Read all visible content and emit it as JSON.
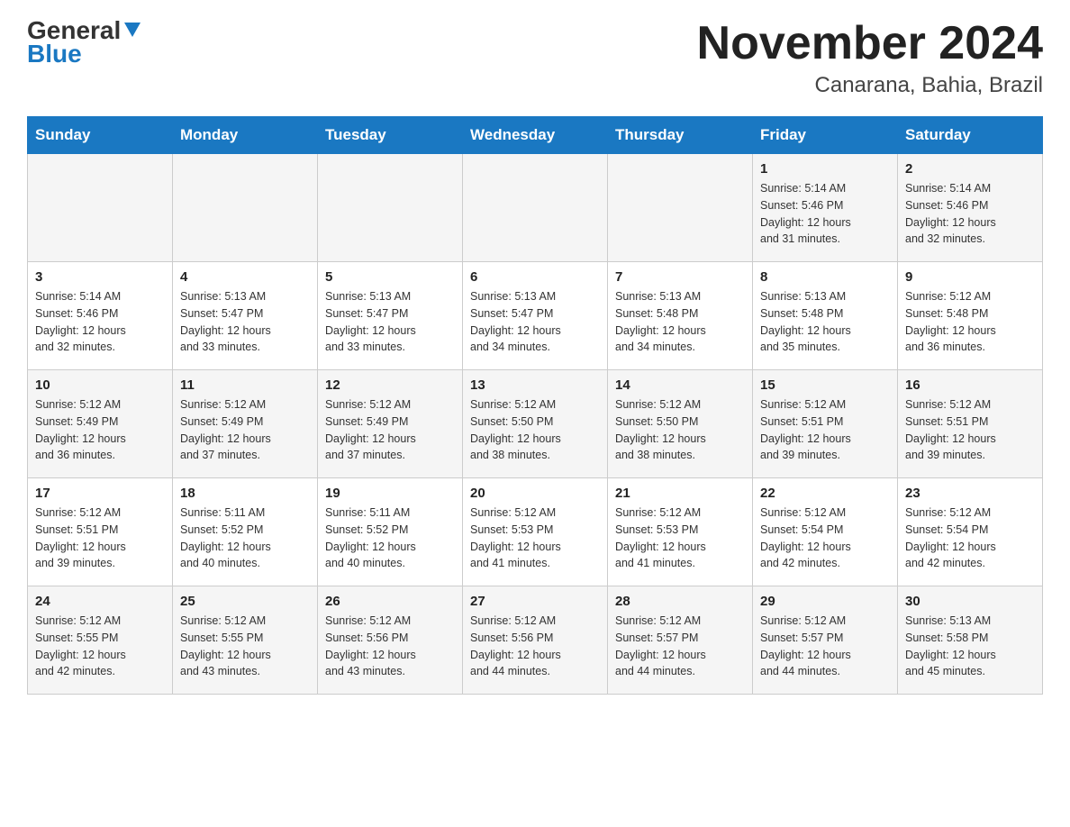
{
  "header": {
    "logo_general": "General",
    "logo_blue": "Blue",
    "month_title": "November 2024",
    "location": "Canarana, Bahia, Brazil"
  },
  "weekdays": [
    "Sunday",
    "Monday",
    "Tuesday",
    "Wednesday",
    "Thursday",
    "Friday",
    "Saturday"
  ],
  "weeks": [
    [
      {
        "day": "",
        "info": ""
      },
      {
        "day": "",
        "info": ""
      },
      {
        "day": "",
        "info": ""
      },
      {
        "day": "",
        "info": ""
      },
      {
        "day": "",
        "info": ""
      },
      {
        "day": "1",
        "info": "Sunrise: 5:14 AM\nSunset: 5:46 PM\nDaylight: 12 hours\nand 31 minutes."
      },
      {
        "day": "2",
        "info": "Sunrise: 5:14 AM\nSunset: 5:46 PM\nDaylight: 12 hours\nand 32 minutes."
      }
    ],
    [
      {
        "day": "3",
        "info": "Sunrise: 5:14 AM\nSunset: 5:46 PM\nDaylight: 12 hours\nand 32 minutes."
      },
      {
        "day": "4",
        "info": "Sunrise: 5:13 AM\nSunset: 5:47 PM\nDaylight: 12 hours\nand 33 minutes."
      },
      {
        "day": "5",
        "info": "Sunrise: 5:13 AM\nSunset: 5:47 PM\nDaylight: 12 hours\nand 33 minutes."
      },
      {
        "day": "6",
        "info": "Sunrise: 5:13 AM\nSunset: 5:47 PM\nDaylight: 12 hours\nand 34 minutes."
      },
      {
        "day": "7",
        "info": "Sunrise: 5:13 AM\nSunset: 5:48 PM\nDaylight: 12 hours\nand 34 minutes."
      },
      {
        "day": "8",
        "info": "Sunrise: 5:13 AM\nSunset: 5:48 PM\nDaylight: 12 hours\nand 35 minutes."
      },
      {
        "day": "9",
        "info": "Sunrise: 5:12 AM\nSunset: 5:48 PM\nDaylight: 12 hours\nand 36 minutes."
      }
    ],
    [
      {
        "day": "10",
        "info": "Sunrise: 5:12 AM\nSunset: 5:49 PM\nDaylight: 12 hours\nand 36 minutes."
      },
      {
        "day": "11",
        "info": "Sunrise: 5:12 AM\nSunset: 5:49 PM\nDaylight: 12 hours\nand 37 minutes."
      },
      {
        "day": "12",
        "info": "Sunrise: 5:12 AM\nSunset: 5:49 PM\nDaylight: 12 hours\nand 37 minutes."
      },
      {
        "day": "13",
        "info": "Sunrise: 5:12 AM\nSunset: 5:50 PM\nDaylight: 12 hours\nand 38 minutes."
      },
      {
        "day": "14",
        "info": "Sunrise: 5:12 AM\nSunset: 5:50 PM\nDaylight: 12 hours\nand 38 minutes."
      },
      {
        "day": "15",
        "info": "Sunrise: 5:12 AM\nSunset: 5:51 PM\nDaylight: 12 hours\nand 39 minutes."
      },
      {
        "day": "16",
        "info": "Sunrise: 5:12 AM\nSunset: 5:51 PM\nDaylight: 12 hours\nand 39 minutes."
      }
    ],
    [
      {
        "day": "17",
        "info": "Sunrise: 5:12 AM\nSunset: 5:51 PM\nDaylight: 12 hours\nand 39 minutes."
      },
      {
        "day": "18",
        "info": "Sunrise: 5:11 AM\nSunset: 5:52 PM\nDaylight: 12 hours\nand 40 minutes."
      },
      {
        "day": "19",
        "info": "Sunrise: 5:11 AM\nSunset: 5:52 PM\nDaylight: 12 hours\nand 40 minutes."
      },
      {
        "day": "20",
        "info": "Sunrise: 5:12 AM\nSunset: 5:53 PM\nDaylight: 12 hours\nand 41 minutes."
      },
      {
        "day": "21",
        "info": "Sunrise: 5:12 AM\nSunset: 5:53 PM\nDaylight: 12 hours\nand 41 minutes."
      },
      {
        "day": "22",
        "info": "Sunrise: 5:12 AM\nSunset: 5:54 PM\nDaylight: 12 hours\nand 42 minutes."
      },
      {
        "day": "23",
        "info": "Sunrise: 5:12 AM\nSunset: 5:54 PM\nDaylight: 12 hours\nand 42 minutes."
      }
    ],
    [
      {
        "day": "24",
        "info": "Sunrise: 5:12 AM\nSunset: 5:55 PM\nDaylight: 12 hours\nand 42 minutes."
      },
      {
        "day": "25",
        "info": "Sunrise: 5:12 AM\nSunset: 5:55 PM\nDaylight: 12 hours\nand 43 minutes."
      },
      {
        "day": "26",
        "info": "Sunrise: 5:12 AM\nSunset: 5:56 PM\nDaylight: 12 hours\nand 43 minutes."
      },
      {
        "day": "27",
        "info": "Sunrise: 5:12 AM\nSunset: 5:56 PM\nDaylight: 12 hours\nand 44 minutes."
      },
      {
        "day": "28",
        "info": "Sunrise: 5:12 AM\nSunset: 5:57 PM\nDaylight: 12 hours\nand 44 minutes."
      },
      {
        "day": "29",
        "info": "Sunrise: 5:12 AM\nSunset: 5:57 PM\nDaylight: 12 hours\nand 44 minutes."
      },
      {
        "day": "30",
        "info": "Sunrise: 5:13 AM\nSunset: 5:58 PM\nDaylight: 12 hours\nand 45 minutes."
      }
    ]
  ]
}
